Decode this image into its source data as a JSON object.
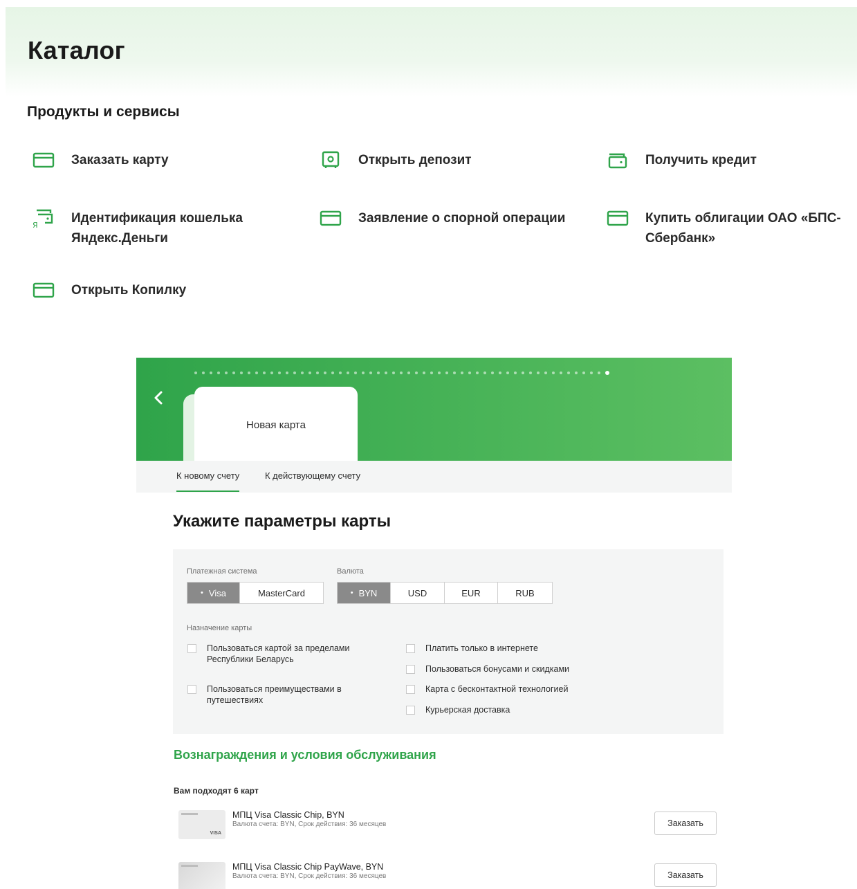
{
  "catalog": {
    "title": "Каталог"
  },
  "services_section": {
    "title": "Продукты и сервисы",
    "items": [
      {
        "label": "Заказать карту",
        "icon": "card-icon"
      },
      {
        "label": "Открыть депозит",
        "icon": "safe-icon"
      },
      {
        "label": "Получить кредит",
        "icon": "wallet-icon"
      },
      {
        "label": "Идентификация кошелька Яндекс.Деньги",
        "icon": "yandex-wallet-icon"
      },
      {
        "label": "Заявление о спорной операции",
        "icon": "card-icon"
      },
      {
        "label": "Купить облигации ОАО «БПС-Сбербанк»",
        "icon": "card-icon"
      },
      {
        "label": "Открыть Копилку",
        "icon": "card-icon"
      }
    ]
  },
  "card_widget": {
    "selected_card": "Новая карта",
    "tabs": [
      {
        "label": "К новому счету",
        "active": true
      },
      {
        "label": "К действующему счету",
        "active": false
      }
    ],
    "params_title": "Укажите параметры карты",
    "payment_system": {
      "label": "Платежная система",
      "options": [
        "Visa",
        "MasterCard"
      ],
      "selected": "Visa"
    },
    "currency": {
      "label": "Валюта",
      "options": [
        "BYN",
        "USD",
        "EUR",
        "RUB"
      ],
      "selected": "BYN"
    },
    "purpose": {
      "label": "Назначение карты",
      "options": [
        {
          "label": "Пользоваться картой за пределами Республики Беларусь",
          "checked": false
        },
        {
          "label": "Пользоваться преимуществами в путешествиях",
          "checked": false
        },
        {
          "label": "Платить только в интернете",
          "checked": false
        },
        {
          "label": "Пользоваться бонусами и скидками",
          "checked": false
        },
        {
          "label": "Карта с бесконтактной технологией",
          "checked": false
        },
        {
          "label": "Курьерская доставка",
          "checked": false
        }
      ]
    },
    "rewards_title": "Вознаграждения и условия обслуживания",
    "fits_text": "Вам подходят 6 карт",
    "offers": [
      {
        "name": "МПЦ Visa Classic Chip, BYN",
        "desc": "Валюта счета: BYN, Срок действия: 36 месяцев",
        "button": "Заказать"
      },
      {
        "name": "МПЦ Visa Classic Chip PayWave, BYN",
        "desc": "Валюта счета: BYN, Срок действия: 36 месяцев",
        "button": "Заказать"
      }
    ],
    "card_thumb_brand": "VISA"
  },
  "colors": {
    "accent": "#2fa44a",
    "header_bg": "#e6f5e6",
    "panel_bg": "#f4f5f5",
    "selected_segment": "#8a8a8a"
  }
}
